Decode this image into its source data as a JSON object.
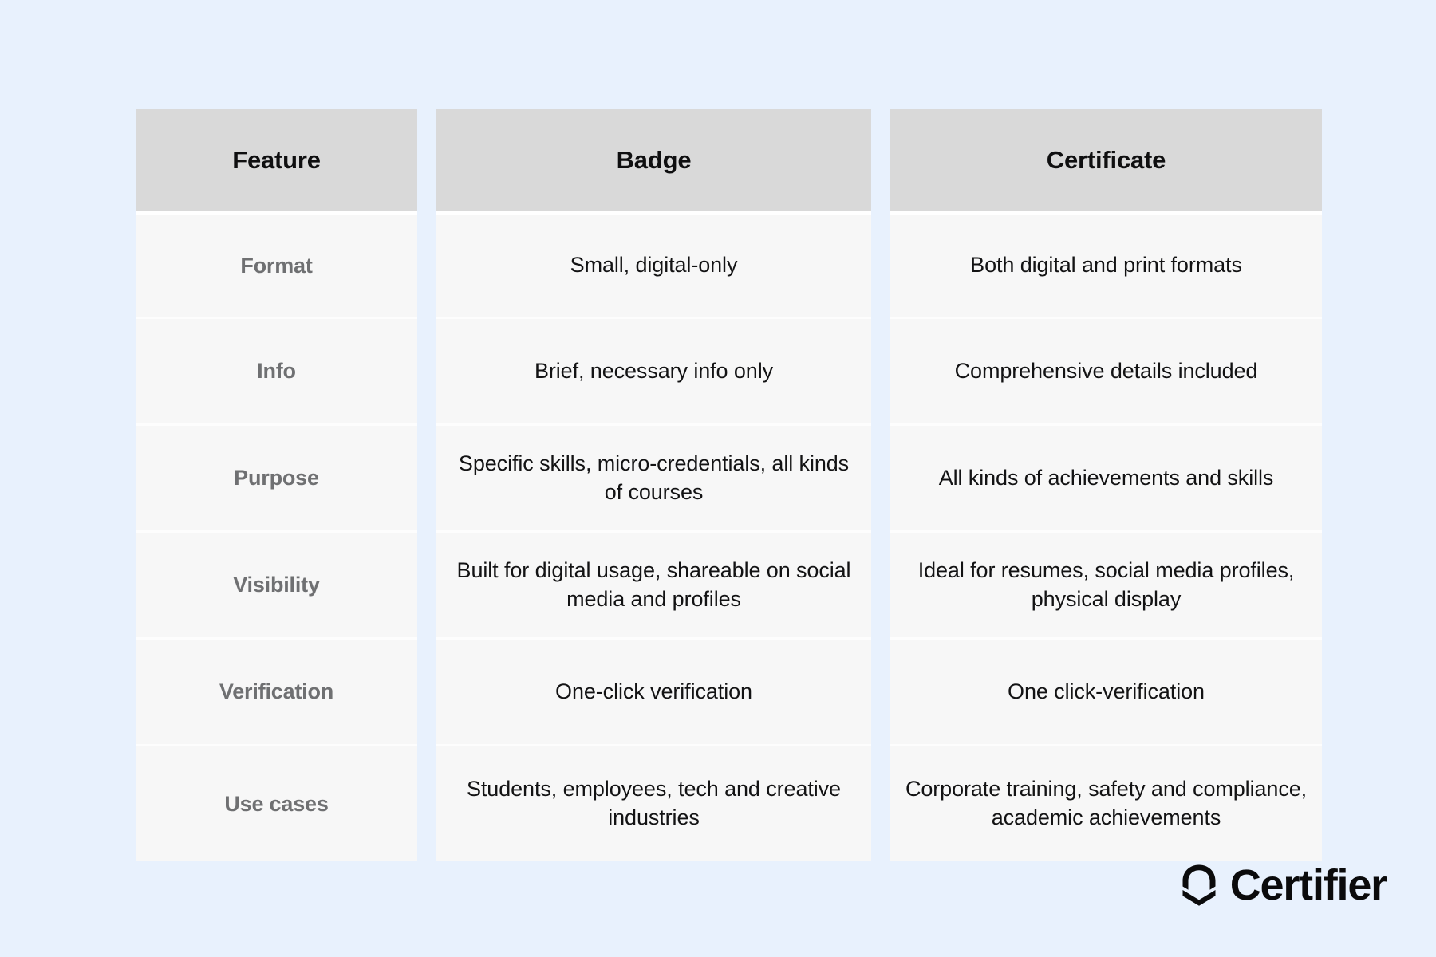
{
  "theme": {
    "page_background": "#e8f1fd",
    "header_cell_background": "#d9d9d9",
    "body_cell_background": "#f7f7f7",
    "header_text_color": "#0f0f10",
    "feature_label_color": "#6f7072",
    "body_text_color": "#131314",
    "brand_color": "#0b0b0c"
  },
  "table": {
    "headers": [
      {
        "label": "Feature"
      },
      {
        "label": "Badge"
      },
      {
        "label": "Certificate"
      }
    ],
    "rows": [
      {
        "feature": "Format",
        "badge": "Small, digital-only",
        "certificate": "Both digital and print formats"
      },
      {
        "feature": "Info",
        "badge": "Brief, necessary info only",
        "certificate": "Comprehensive details included"
      },
      {
        "feature": "Purpose",
        "badge": "Specific skills, micro-credentials, all kinds of courses",
        "certificate": "All kinds of achievements and skills"
      },
      {
        "feature": "Visibility",
        "badge": "Built for digital usage, shareable on social media and profiles",
        "certificate": "Ideal for resumes, social media profiles, physical display"
      },
      {
        "feature": "Verification",
        "badge": "One-click verification",
        "certificate": "One click-verification"
      },
      {
        "feature": "Use cases",
        "badge": "Students, employees, tech and creative industries",
        "certificate": "Corporate training, safety and compliance, academic achievements"
      }
    ]
  },
  "brand": {
    "name": "Certifier",
    "mark_icon": "certifier-shield-chevron-logo-icon"
  }
}
